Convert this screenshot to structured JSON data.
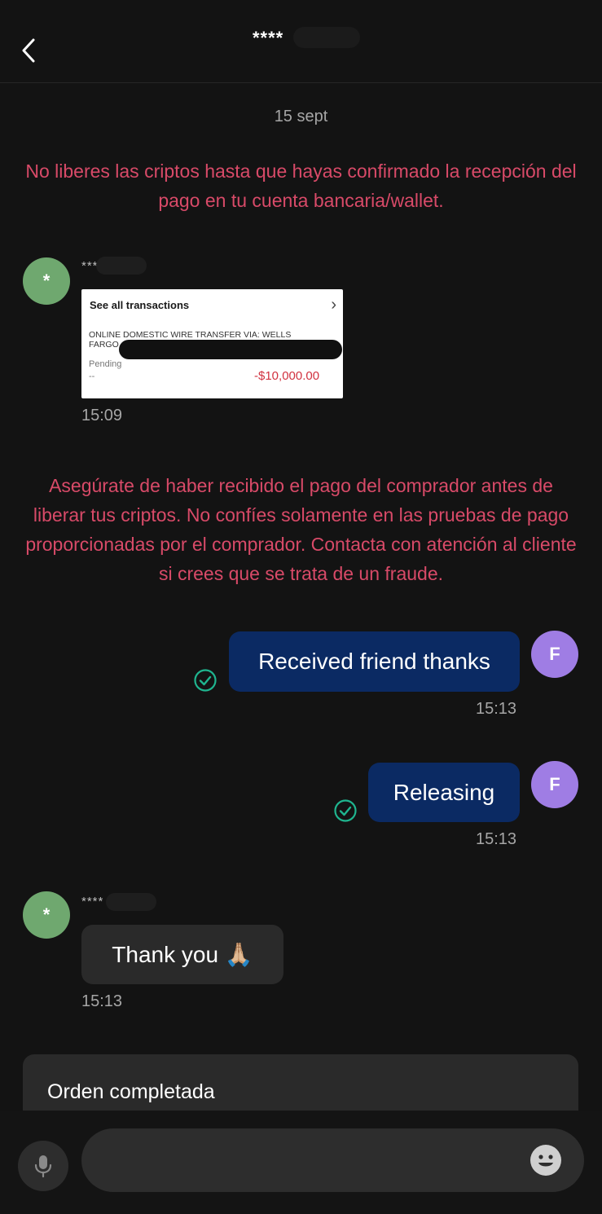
{
  "header": {
    "title": "****",
    "back_icon": "chevron-left-icon"
  },
  "chat": {
    "date_separator": "15 sept",
    "warning_1": "No liberes las criptos hasta que hayas confirmado la recepción del pago en tu cuenta bancaria/wallet.",
    "warning_2": "Asegúrate de haber recibido el pago del comprador antes de liberar tus criptos. No confíes solamente en las pruebas de pago proporcionadas por el comprador. Contacta con atención al cliente si crees que se trata de un fraude.",
    "messages": [
      {
        "sender": "other",
        "sender_name": "****",
        "avatar_letter": "*",
        "type": "image",
        "receipt": {
          "heading": "See all transactions",
          "description": "ONLINE DOMESTIC WIRE TRANSFER VIA: WELLS FARGO",
          "status": "Pending",
          "dash": "--",
          "amount": "-$10,000.00"
        },
        "time": "15:09"
      },
      {
        "sender": "self",
        "avatar_letter": "F",
        "text": "Received friend thanks",
        "time": "15:13",
        "status": "read"
      },
      {
        "sender": "self",
        "avatar_letter": "F",
        "text": "Releasing",
        "time": "15:13",
        "status": "read"
      },
      {
        "sender": "other",
        "sender_name": "****",
        "avatar_letter": "*",
        "text": "Thank you 🙏🏼",
        "time": "15:13"
      }
    ]
  },
  "order_banner": {
    "text": "Orden completada"
  },
  "composer": {
    "placeholder": "",
    "mic_icon": "microphone-icon",
    "emoji_icon": "emoji-icon"
  },
  "colors": {
    "background": "#131313",
    "warning": "#d84a68",
    "self_bubble": "#0b2a63",
    "other_bubble": "#2a2a2a",
    "self_avatar": "#9f7de4",
    "other_avatar": "#6fa86f",
    "check": "#1fb58f"
  }
}
